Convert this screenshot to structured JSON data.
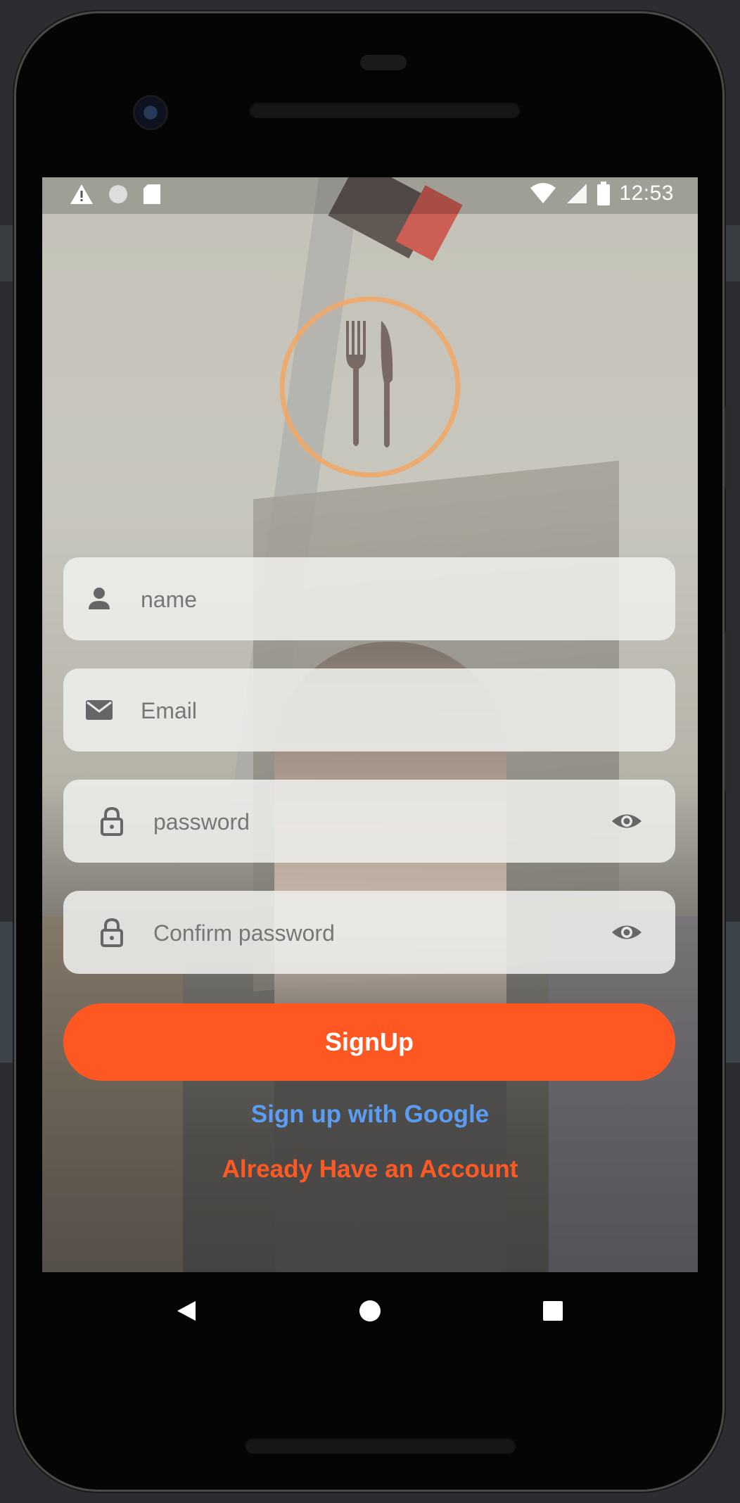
{
  "status_bar": {
    "time": "12:53",
    "left_icons": [
      "warning-icon",
      "circle-icon",
      "sd-card-icon"
    ],
    "right_icons": [
      "wifi-icon",
      "signal-icon",
      "battery-icon"
    ]
  },
  "logo": {
    "icon": "fork-knife-icon",
    "ring_color": "#f0a868"
  },
  "form": {
    "name_placeholder": "name",
    "email_placeholder": "Email",
    "password_placeholder": "password",
    "confirm_password_placeholder": "Confirm password"
  },
  "actions": {
    "signup_label": "SignUp",
    "google_label": "Sign up with Google",
    "account_label": "Already Have an Account"
  },
  "colors": {
    "accent": "#ff5722",
    "google_link": "#5b9df3",
    "account_link": "#ff5a24"
  },
  "nav": {
    "back": "back-icon",
    "home": "home-icon",
    "recents": "recents-icon"
  }
}
